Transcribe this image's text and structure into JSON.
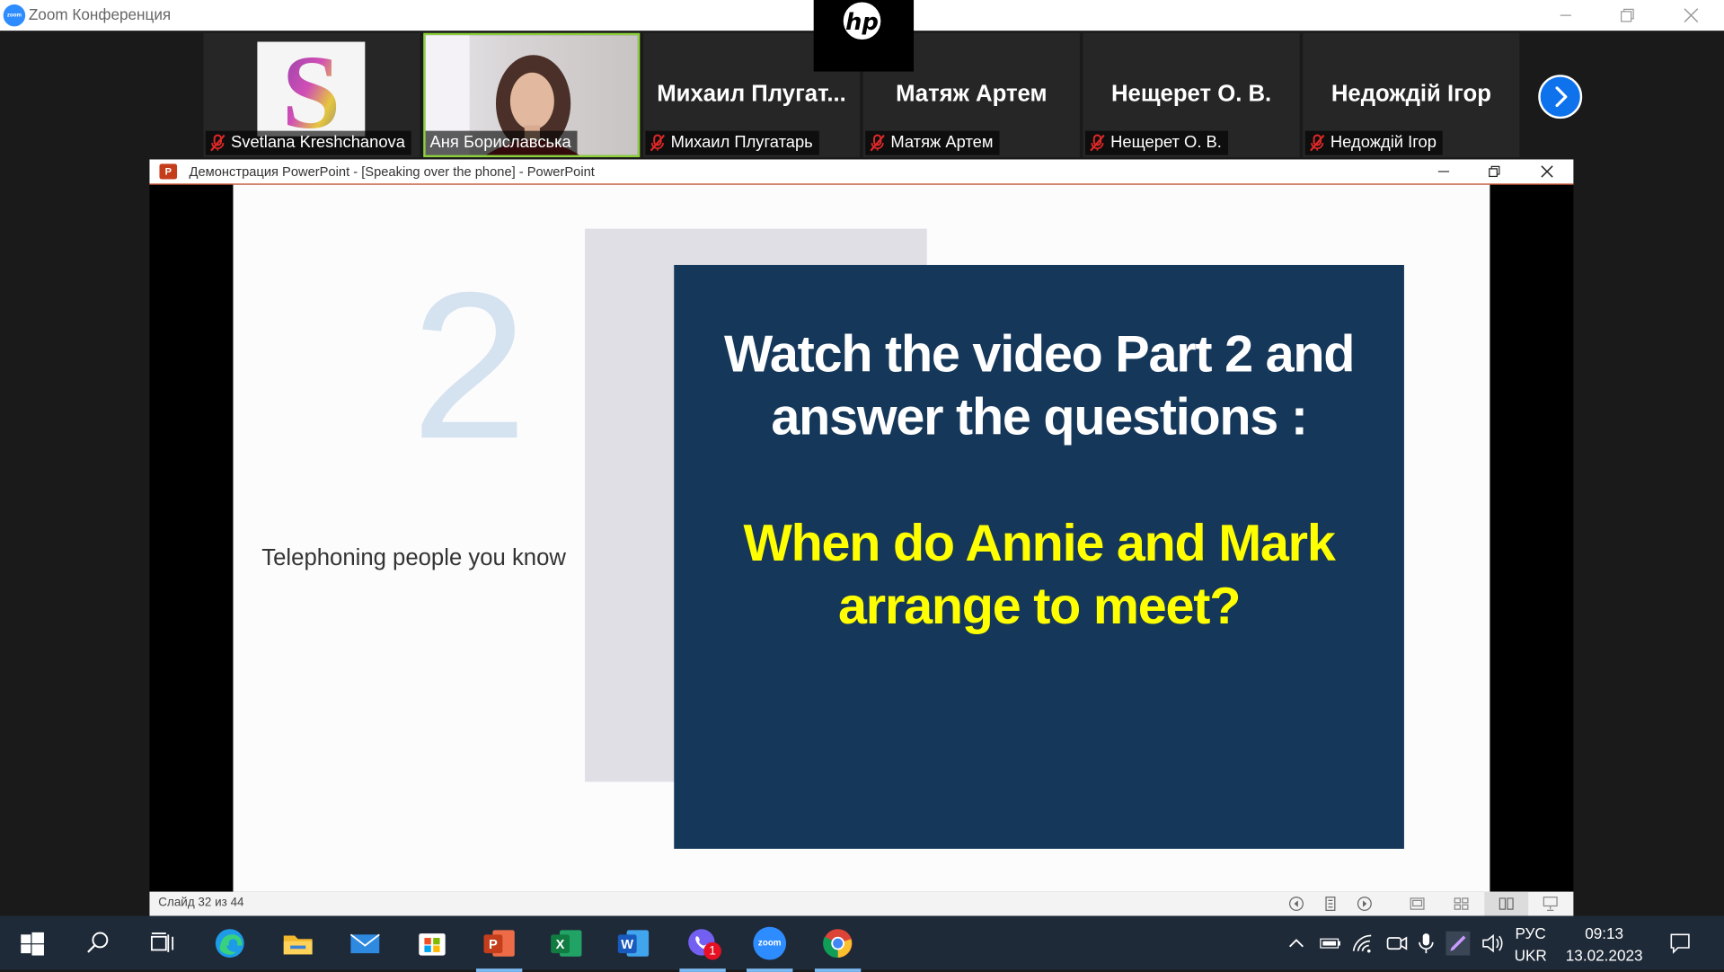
{
  "zoom_window": {
    "title": "Zoom Конференция",
    "logo_text": "zoom"
  },
  "participants": [
    {
      "name": "Svetlana Kreshchanova",
      "display": "avatar",
      "muted": true
    },
    {
      "name": "Аня Бориславська",
      "display": "video",
      "muted": false,
      "active_speaker": true
    },
    {
      "name": "Михаил Плугатарь",
      "big_name": "Михаил  Плугат...",
      "display": "name",
      "muted": true
    },
    {
      "name": "Матяж Артем",
      "big_name": "Матяж Артем",
      "display": "name",
      "muted": true
    },
    {
      "name": "Нещерет О. В.",
      "big_name": "Нещерет О. В.",
      "display": "name",
      "muted": true
    },
    {
      "name": "Недождій Ігор",
      "big_name": "Недождій Ігор",
      "display": "name",
      "muted": true
    }
  ],
  "powerpoint": {
    "title": "Демонстрация PowerPoint - [Speaking over the phone] - PowerPoint",
    "icon_letter": "P",
    "status": "Слайд 32 из 44"
  },
  "slide": {
    "number": "2",
    "subtitle": "Telephoning people you know",
    "heading_line1": "Watch the video Part 2 and",
    "heading_line2": "answer the questions :",
    "question_line1": "When do Annie and Mark",
    "question_line2": "arrange to meet?"
  },
  "taskbar": {
    "viber_badge": "1",
    "zoom_icon_text": "zoom",
    "language_top": "РУС",
    "language_bottom": "UKR",
    "time": "09:13",
    "date": "13.02.2023"
  },
  "colors": {
    "slide_box": "#14375a",
    "question_text": "#ffff00",
    "active_speaker_border": "#8cd03b",
    "zoom_blue": "#0e72ed"
  }
}
